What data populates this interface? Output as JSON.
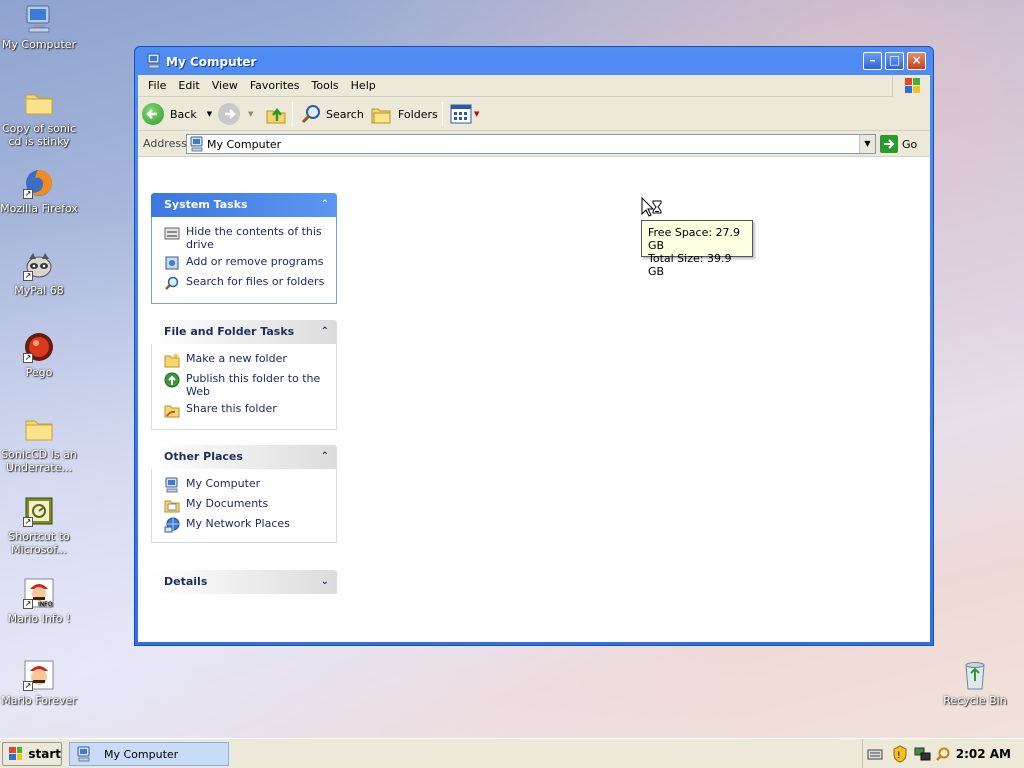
{
  "desktop": {
    "icons": [
      {
        "label": "My Computer"
      },
      {
        "label": "Copy of sonic cd is stinky"
      },
      {
        "label": "Mozilla Firefox"
      },
      {
        "label": "MyPal 68"
      },
      {
        "label": "Pego"
      },
      {
        "label": "SonicCD Is an Underrate..."
      },
      {
        "label": "Shortcut to Microsof..."
      },
      {
        "label": "Mario Info !"
      },
      {
        "label": "Mario Forever"
      },
      {
        "label": "Recycle Bin"
      }
    ]
  },
  "window": {
    "title": "My Computer",
    "menu": [
      "File",
      "Edit",
      "View",
      "Favorites",
      "Tools",
      "Help"
    ],
    "toolbar": {
      "back": "Back",
      "search": "Search",
      "folders": "Folders"
    },
    "address": {
      "label": "Address",
      "value": "My Computer",
      "go": "Go"
    },
    "panels": {
      "system_tasks": {
        "title": "System Tasks",
        "items": [
          "Hide the contents of this drive",
          "Add or remove programs",
          "Search for files or folders"
        ]
      },
      "file_folder_tasks": {
        "title": "File and Folder Tasks",
        "items": [
          "Make a new folder",
          "Publish this folder to the Web",
          "Share this folder"
        ]
      },
      "other_places": {
        "title": "Other Places",
        "items": [
          "My Computer",
          "My Documents",
          "My Network Places"
        ]
      },
      "details": {
        "title": "Details"
      }
    },
    "tooltip": {
      "free": "Free Space: 27.9 GB",
      "total": "Total Size: 39.9 GB"
    }
  },
  "taskbar": {
    "start": "start",
    "task": "My Computer",
    "clock": "2:02 AM"
  },
  "colors": {
    "titlebar": "#2f6fe8",
    "panel_header": "#3b78e0",
    "tooltip_bg": "#ffffe1"
  }
}
